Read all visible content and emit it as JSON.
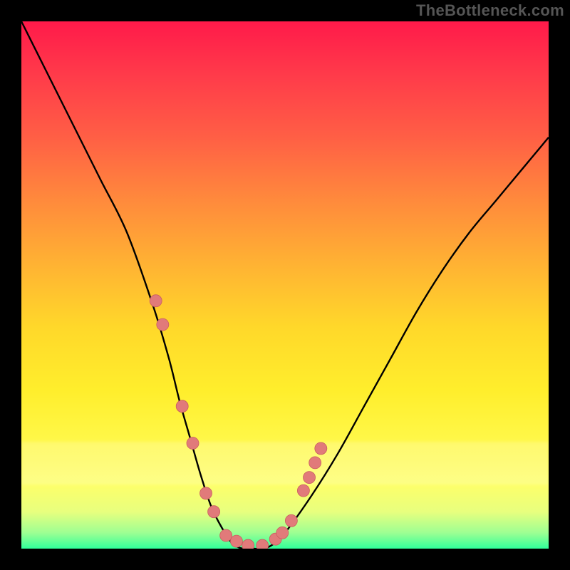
{
  "watermark": "TheBottleneck.com",
  "colors": {
    "bg_black": "#000000",
    "curve": "#000000",
    "marker_fill": "#e17a7a",
    "marker_stroke": "#c95f5f",
    "gradient_top": "#ff1a4a",
    "gradient_bottom": "#31ff9a"
  },
  "chart_data": {
    "type": "line",
    "title": "",
    "xlabel": "",
    "ylabel": "",
    "xlim": [
      0,
      100
    ],
    "ylim": [
      0,
      100
    ],
    "grid": false,
    "series": [
      {
        "name": "curve",
        "x": [
          0,
          5,
          10,
          15,
          20,
          25,
          28,
          30,
          32,
          34,
          36,
          38,
          40,
          42,
          44,
          46,
          48,
          50,
          55,
          60,
          65,
          70,
          75,
          80,
          85,
          90,
          95,
          100
        ],
        "y": [
          100,
          90,
          80,
          70,
          60,
          46,
          36,
          28,
          21,
          14,
          8,
          4,
          1,
          0,
          0,
          0,
          1,
          3,
          10,
          18,
          27,
          36,
          45,
          53,
          60,
          66,
          72,
          78
        ]
      }
    ],
    "markers": {
      "name": "dots",
      "x": [
        25.5,
        26.8,
        30.5,
        32.5,
        35.0,
        36.5,
        38.8,
        40.8,
        43.0,
        45.7,
        48.2,
        49.5,
        51.2,
        53.5,
        54.6,
        55.7,
        56.8
      ],
      "y": [
        47.0,
        42.5,
        27.0,
        20.0,
        10.5,
        7.0,
        2.5,
        1.4,
        0.6,
        0.6,
        1.8,
        3.0,
        5.3,
        11.0,
        13.5,
        16.3,
        19.0
      ]
    }
  }
}
